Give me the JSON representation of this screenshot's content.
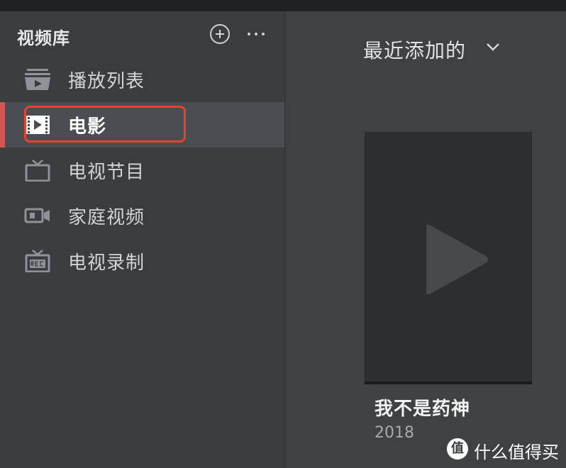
{
  "sidebar": {
    "title": "视频库",
    "items": [
      {
        "label": "播放列表",
        "icon": "playlist-icon"
      },
      {
        "label": "电影",
        "icon": "film-icon",
        "active": true
      },
      {
        "label": "电视节目",
        "icon": "tv-icon"
      },
      {
        "label": "家庭视频",
        "icon": "camera-icon"
      },
      {
        "label": "电视录制",
        "icon": "tv-rec-icon"
      }
    ],
    "add_icon": "plus-circle-icon",
    "more_icon": "ellipsis-icon"
  },
  "main": {
    "sort_label": "最近添加的",
    "sort_icon": "chevron-down-icon",
    "movies": [
      {
        "title": "我不是药神",
        "year": "2018",
        "poster_icon": "play-icon"
      }
    ]
  },
  "watermark": {
    "badge": "值",
    "text": "什么值得买"
  },
  "colors": {
    "active_indicator": "#d9534f",
    "highlight_box": "#e8412c",
    "sidebar_bg": "#3a3d40",
    "main_bg": "#3f4245"
  }
}
